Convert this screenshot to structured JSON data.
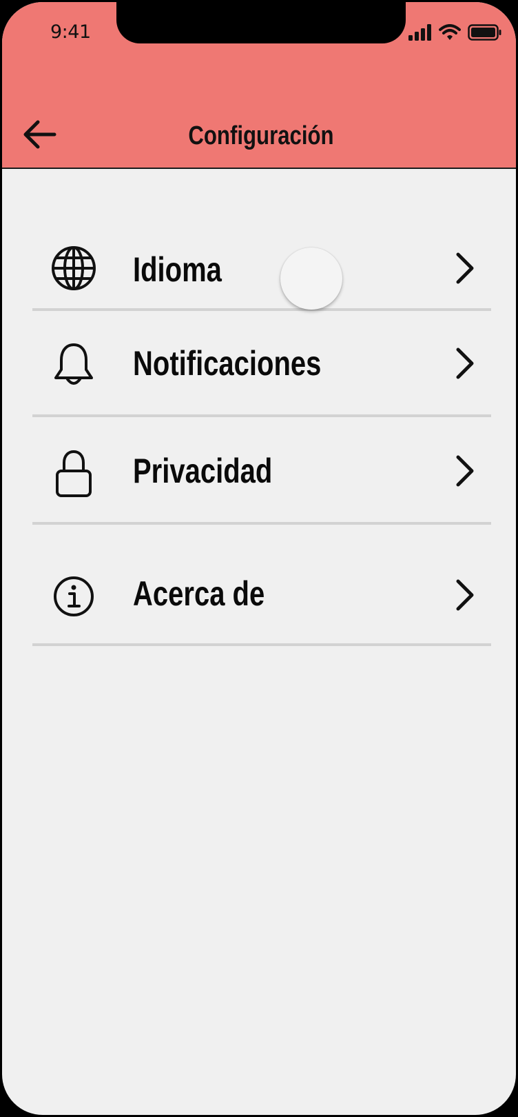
{
  "status_bar": {
    "time": "9:41",
    "signal_icon": "cellular-signal-icon",
    "wifi_icon": "wifi-icon",
    "battery_icon": "battery-icon"
  },
  "header": {
    "title": "Configuración",
    "back_icon": "arrow-left-icon",
    "background_color": "#ef7873"
  },
  "settings": {
    "items": [
      {
        "label": "Idioma",
        "icon": "globe-icon"
      },
      {
        "label": "Notificaciones",
        "icon": "bell-icon"
      },
      {
        "label": "Privacidad",
        "icon": "lock-icon"
      },
      {
        "label": "Acerca de",
        "icon": "info-icon"
      }
    ]
  }
}
